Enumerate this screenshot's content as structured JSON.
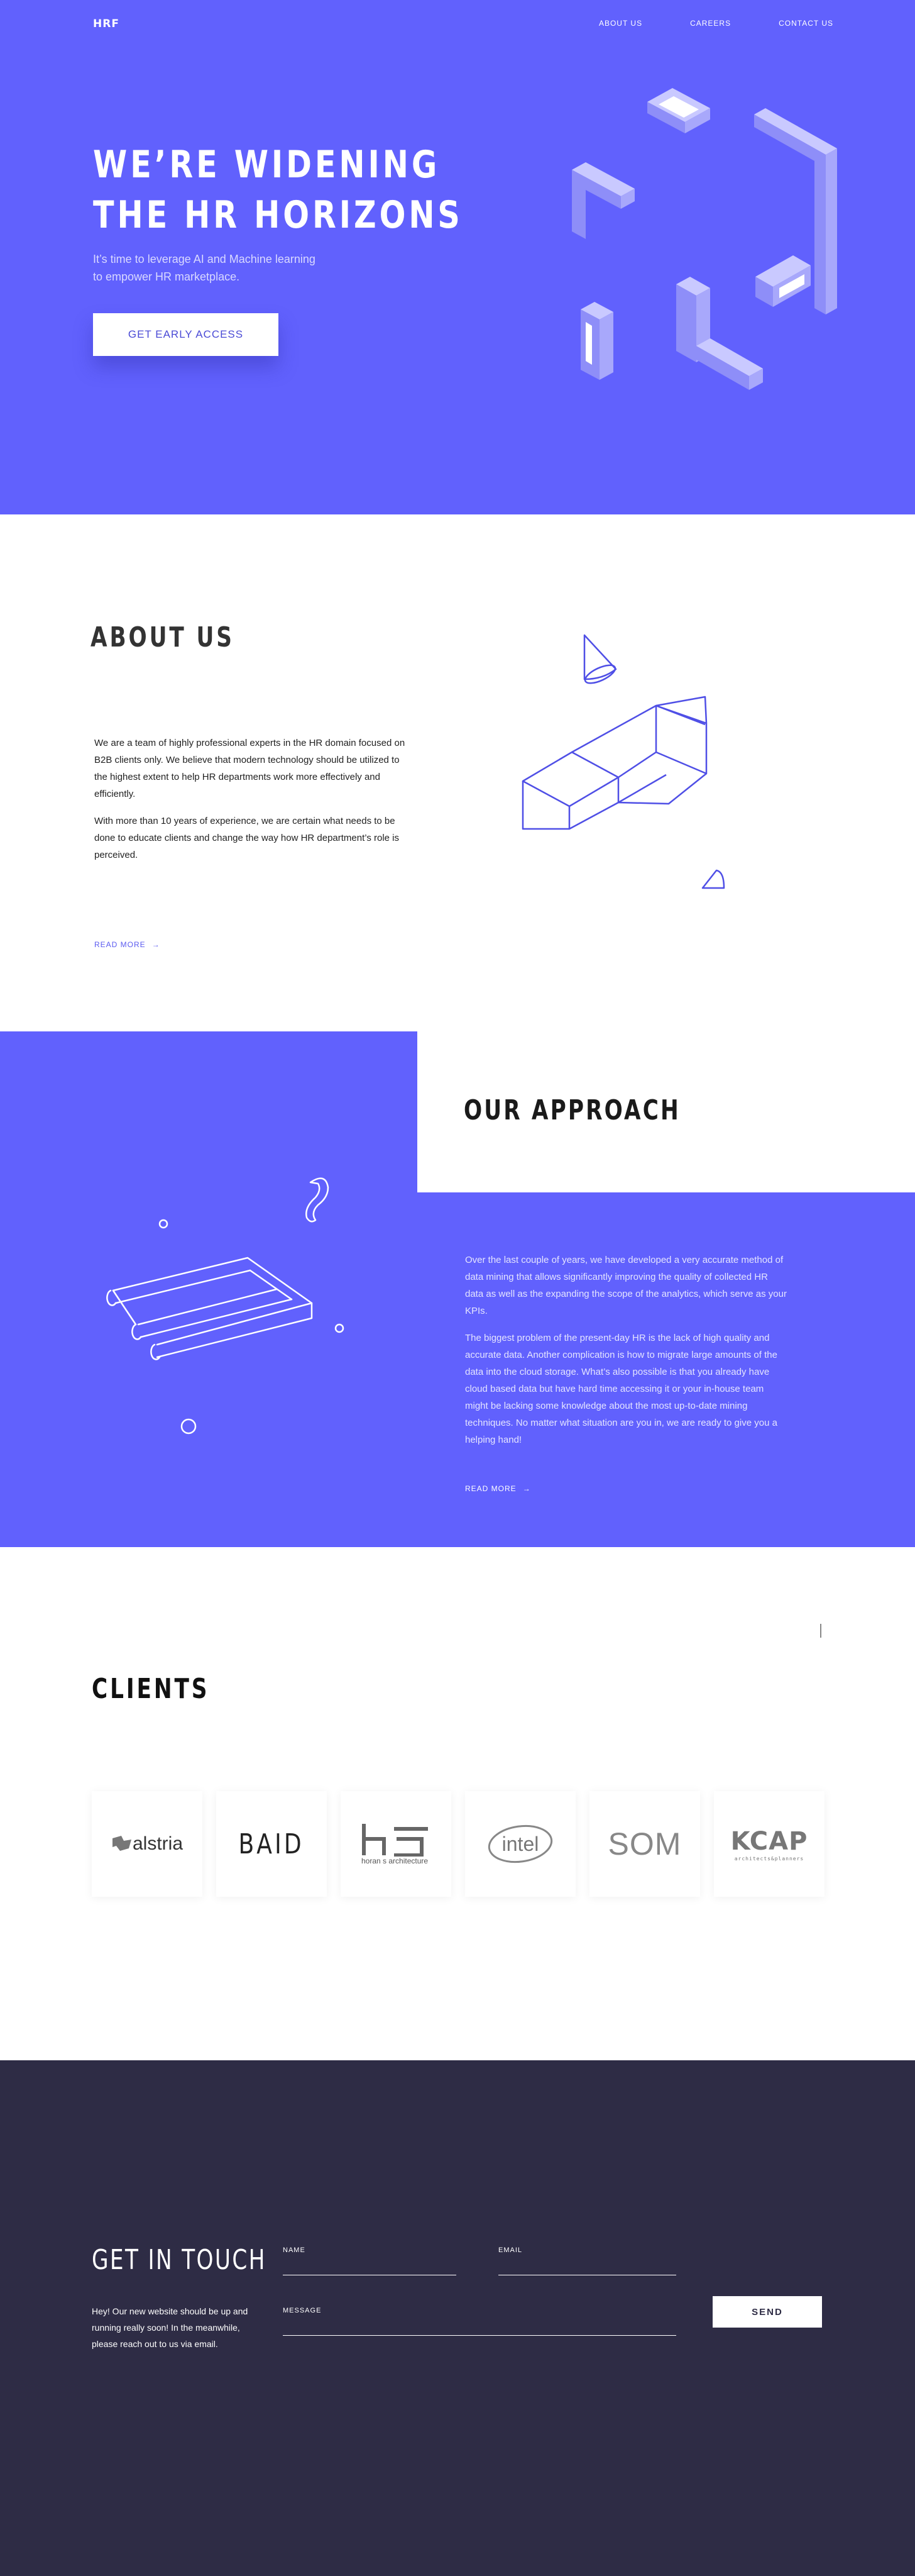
{
  "header": {
    "logo": "HRF",
    "nav": [
      {
        "label": "ABOUT US"
      },
      {
        "label": "CAREERS"
      },
      {
        "label": "CONTACT US"
      }
    ]
  },
  "hero": {
    "title_line1": "WE’RE WIDENING",
    "title_line2": "THE HR HORIZONS",
    "subtitle_line1": "It’s time to leverage AI and Machine learning",
    "subtitle_line2": "to empower HR marketplace.",
    "cta_label": "GET EARLY ACCESS"
  },
  "about": {
    "title": "ABOUT US",
    "paragraph1": "We are a team of highly professional experts in the HR domain focused on B2B clients only. We believe that modern technology should be utilized to the highest extent to help HR departments work more effectively and efficiently.",
    "paragraph2": "With more than 10 years of experience, we are certain what needs to be done to educate clients and change the way how HR department’s role is perceived.",
    "read_more": "READ MORE"
  },
  "approach": {
    "title": "OUR APPROACH",
    "paragraph1": "Over the last couple of years, we have developed a very accurate method of data mining that allows significantly improving the quality of collected HR data as well as the expanding the scope of the analytics, which serve as your KPIs.",
    "paragraph2": "The biggest problem of the present-day HR is the lack of high quality and accurate data. Another complication is how to migrate large amounts of the data into the cloud storage. What’s also possible is that you already have cloud based data but have hard time accessing it or your in-house team might be lacking some knowledge about the most up-to-date mining techniques. No matter what situation are you in, we are ready to give you a helping hand!",
    "read_more": "READ MORE"
  },
  "clients": {
    "title": "CLIENTS",
    "logos": [
      {
        "name": "alstria"
      },
      {
        "name": "BAID"
      },
      {
        "name": "horan s architecture"
      },
      {
        "name": "intel"
      },
      {
        "name": "SOM"
      },
      {
        "name": "KCAP",
        "sub": "architects&planners"
      }
    ]
  },
  "contact": {
    "title": "GET IN TOUCH",
    "text": "Hey! Our new website should be up and running really soon! In the meanwhile, please reach out to us via email.",
    "name_label": "NAME",
    "email_label": "EMAIL",
    "message_label": "MESSAGE",
    "send_label": "SEND"
  },
  "colors": {
    "brand": "#6161fd",
    "dark": "#2e2c45",
    "white": "#ffffff"
  }
}
